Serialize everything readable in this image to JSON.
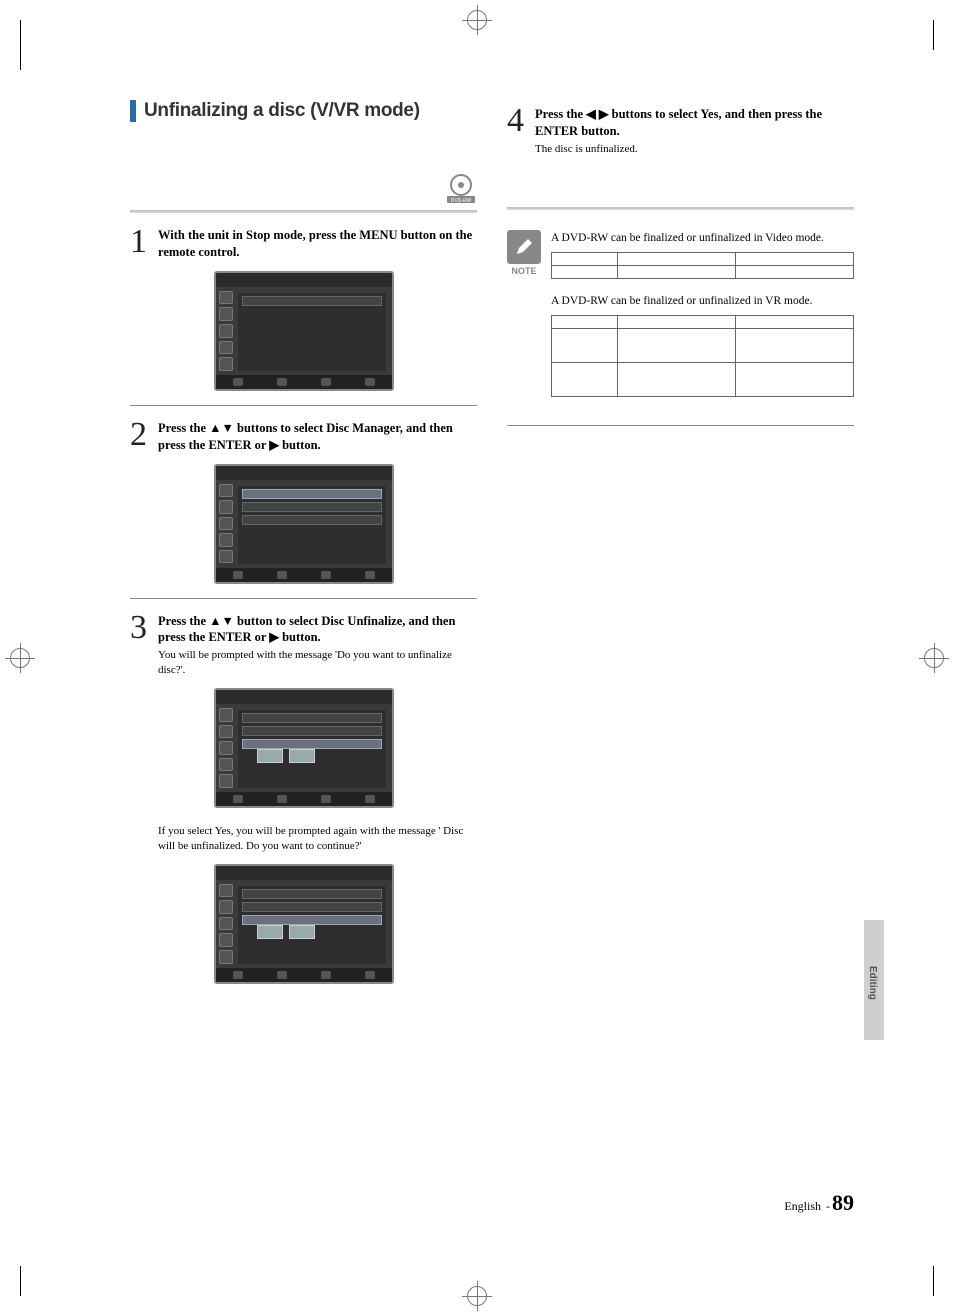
{
  "section_title": "Unfinalizing a disc (V/VR mode)",
  "disc_badge_label": "DVD-RW",
  "steps": {
    "s1": {
      "num": "1",
      "text": "With the unit in Stop mode, press the MENU button on the remote control."
    },
    "s2": {
      "num": "2",
      "text": "Press the ▲▼ buttons to select Disc Manager, and then press the ENTER or ▶ button."
    },
    "s3": {
      "num": "3",
      "text": "Press the ▲▼ button to select Disc Unfinalize, and then press the ENTER or ▶ button.",
      "sub": "You will be prompted with the message 'Do you want to unfinalize disc?'."
    },
    "s3b_sub": "If you select Yes, you will be prompted again with the message ' Disc will be unfinalized. Do you want to continue?'",
    "s4": {
      "num": "4",
      "text": "Press the ◀ ▶ buttons to select Yes, and then press the ENTER button.",
      "sub": "The disc is unfinalized."
    }
  },
  "note": {
    "label": "NOTE",
    "line1": "A DVD-RW can be finalized or unfinalized in Video mode.",
    "line2": "A DVD-RW can be finalized or unfinalized in VR mode."
  },
  "side_tab": "Editing",
  "footer": {
    "lang": "English",
    "dash": "-",
    "num": "89"
  }
}
